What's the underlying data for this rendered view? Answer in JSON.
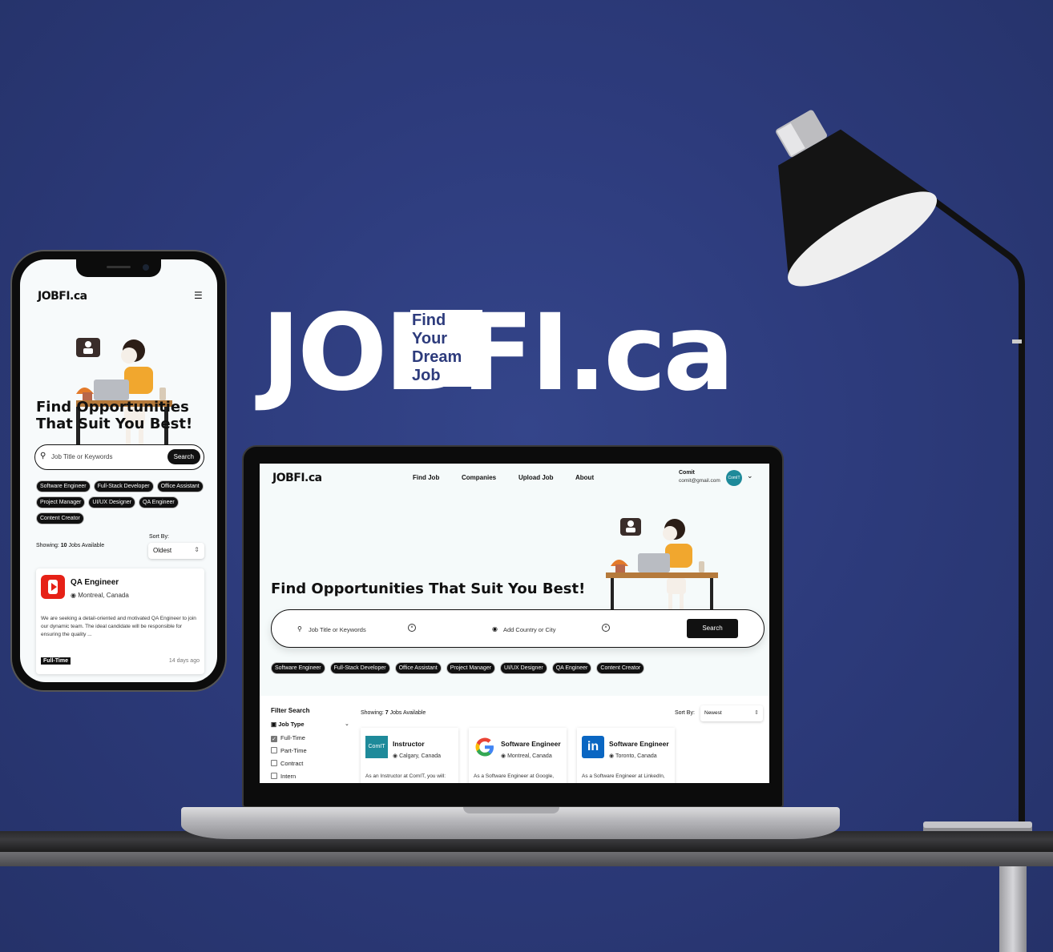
{
  "brand": {
    "name": "JOBFI.ca",
    "name_display": "JOBFI.ca",
    "tagline": [
      "Find",
      "Your",
      "Dream",
      "Job"
    ]
  },
  "colors": {
    "background": "#2d3b7c",
    "accent": "#111111",
    "youtube": "#e62117",
    "comit": "#1e8a9a",
    "linkedin": "#0a66c2"
  },
  "mobile": {
    "logo": "JOBFI.ca",
    "menu_icon": "hamburger-icon",
    "hero_title": "Find Opportunities That Suit You Best!",
    "search": {
      "placeholder": "Job Title or Keywords",
      "button": "Search"
    },
    "chips": [
      "Software Engineer",
      "Full-Stack Developer",
      "Office Assistant",
      "Project Manager",
      "UI/UX Designer",
      "QA Engineer",
      "Content Creator"
    ],
    "showing": {
      "prefix": "Showing: ",
      "count": "10",
      "suffix": " Jobs Available"
    },
    "sort": {
      "label": "Sort By:",
      "value": "Oldest"
    },
    "job": {
      "title": "QA Engineer",
      "location": "Montreal, Canada",
      "description": "We are seeking a detail-oriented and motivated QA Engineer to join our dynamic team. The ideal candidate will be responsible for ensuring the quality ...",
      "type": "Full-Time",
      "posted": "14 days ago"
    }
  },
  "desktop": {
    "logo": "JOBFI.ca",
    "nav": [
      "Find Job",
      "Companies",
      "Upload Job",
      "About"
    ],
    "user": {
      "name": "Comit",
      "email": "comit@gmail.com",
      "avatar": "ComIT"
    },
    "hero_title": "Find Opportunities That Suit You Best!",
    "search": {
      "keyword_placeholder": "Job Title or Keywords",
      "location_placeholder": "Add Country or City",
      "button": "Search"
    },
    "chips": [
      "Software Engineer",
      "Full-Stack Developer",
      "Office Assistant",
      "Project Manager",
      "UI/UX Designer",
      "QA Engineer",
      "Content Creator"
    ],
    "filter": {
      "title": "Filter Search",
      "group": "Job Type",
      "options": [
        {
          "label": "Full-Time",
          "checked": true
        },
        {
          "label": "Part-Time",
          "checked": false
        },
        {
          "label": "Contract",
          "checked": false
        },
        {
          "label": "Intern",
          "checked": false
        }
      ]
    },
    "showing": {
      "prefix": "Showing: ",
      "count": "7",
      "suffix": " Jobs Available"
    },
    "sort": {
      "label": "Sort By:",
      "value": "Newest"
    },
    "jobs": [
      {
        "title": "Instructor",
        "location": "Calgary, Canada",
        "description": "As an Instructor at ComIT, you will:",
        "logo": "ComIT"
      },
      {
        "title": "Software Engineer",
        "location": "Montreal, Canada",
        "description": "As a Software Engineer at Google,",
        "logo": "G"
      },
      {
        "title": "Software Engineer",
        "location": "Toronto, Canada",
        "description": "As a Software Engineer at LinkedIn,",
        "logo": "in"
      }
    ]
  }
}
